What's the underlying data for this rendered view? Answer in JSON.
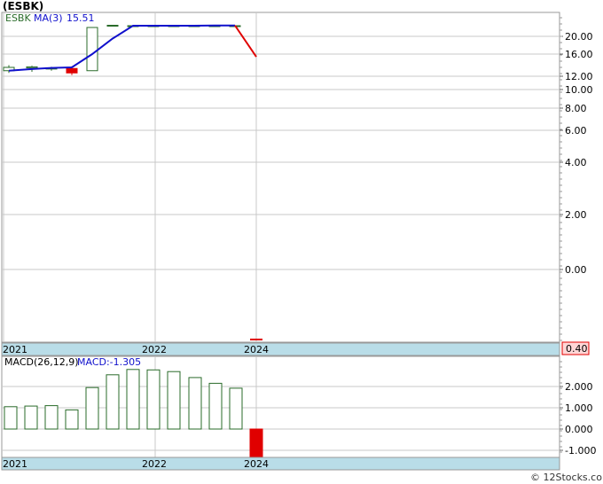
{
  "header": {
    "ticker_label": "(ESBK)",
    "footer_credit": "© 12Stocks.com"
  },
  "colors": {
    "up_candle": "#2a6b2a",
    "down_candle": "#e00000",
    "ma_line": "#1010cc",
    "last_segment": "#e00000",
    "axis_band": "#b9dde8",
    "grid": "#c8c8c8",
    "price_tag_bg": "#ffd6d6"
  },
  "chart_data": [
    {
      "type": "candlestick",
      "title": "",
      "legend": {
        "symbol": "ESBK",
        "ma_label": "MA(3)",
        "ma_value": "15.51"
      },
      "x_ticks": [
        "2021",
        "2022",
        "2024"
      ],
      "y_ticks": [
        "20.00",
        "16.00",
        "12.00",
        "10.00",
        "8.00",
        "6.00",
        "4.00",
        "2.00",
        "0.00"
      ],
      "price_tag": "0.40",
      "candles": [
        {
          "open": 13.0,
          "close": 13.6,
          "high": 14.0,
          "low": 12.6
        },
        {
          "open": 13.5,
          "close": 13.7,
          "high": 13.9,
          "low": 12.8
        },
        {
          "open": 13.3,
          "close": 13.5,
          "high": 13.7,
          "low": 13.0
        },
        {
          "open": 13.4,
          "close": 12.6,
          "high": 13.8,
          "low": 12.2
        },
        {
          "open": 13.0,
          "close": 22.0,
          "high": 22.0,
          "low": 13.0
        },
        {
          "open": 22.5,
          "close": 22.5,
          "high": 22.5,
          "low": 22.5
        },
        {
          "open": 22.4,
          "close": 22.4,
          "high": 22.4,
          "low": 22.4
        },
        {
          "open": 22.4,
          "close": 22.4,
          "high": 22.4,
          "low": 22.4
        },
        {
          "open": 22.4,
          "close": 22.4,
          "high": 22.4,
          "low": 22.4
        },
        {
          "open": 22.4,
          "close": 22.4,
          "high": 22.4,
          "low": 22.4
        },
        {
          "open": 22.4,
          "close": 22.4,
          "high": 22.4,
          "low": 22.4
        },
        {
          "open": 22.4,
          "close": 22.4,
          "high": 22.4,
          "low": 22.4
        },
        {
          "open": 0.4,
          "close": 0.4,
          "high": 0.4,
          "low": 0.4
        }
      ],
      "ma_values": [
        13.0,
        13.3,
        13.5,
        13.6,
        16.0,
        19.5,
        22.4,
        22.4,
        22.4,
        22.4,
        22.45,
        22.45,
        15.51
      ]
    },
    {
      "type": "bar",
      "legend": {
        "label": "MACD(26,12,9)",
        "value_label": "MACD:-1.305"
      },
      "x_ticks": [
        "2021",
        "2022",
        "2024"
      ],
      "y_ticks": [
        "2.000",
        "1.000",
        "0.000",
        "-1.000"
      ],
      "ylim": [
        -1.3,
        2.95
      ],
      "values": [
        1.05,
        1.08,
        1.1,
        0.9,
        1.95,
        2.55,
        2.8,
        2.78,
        2.7,
        2.42,
        2.15,
        1.92,
        -1.305
      ]
    }
  ]
}
